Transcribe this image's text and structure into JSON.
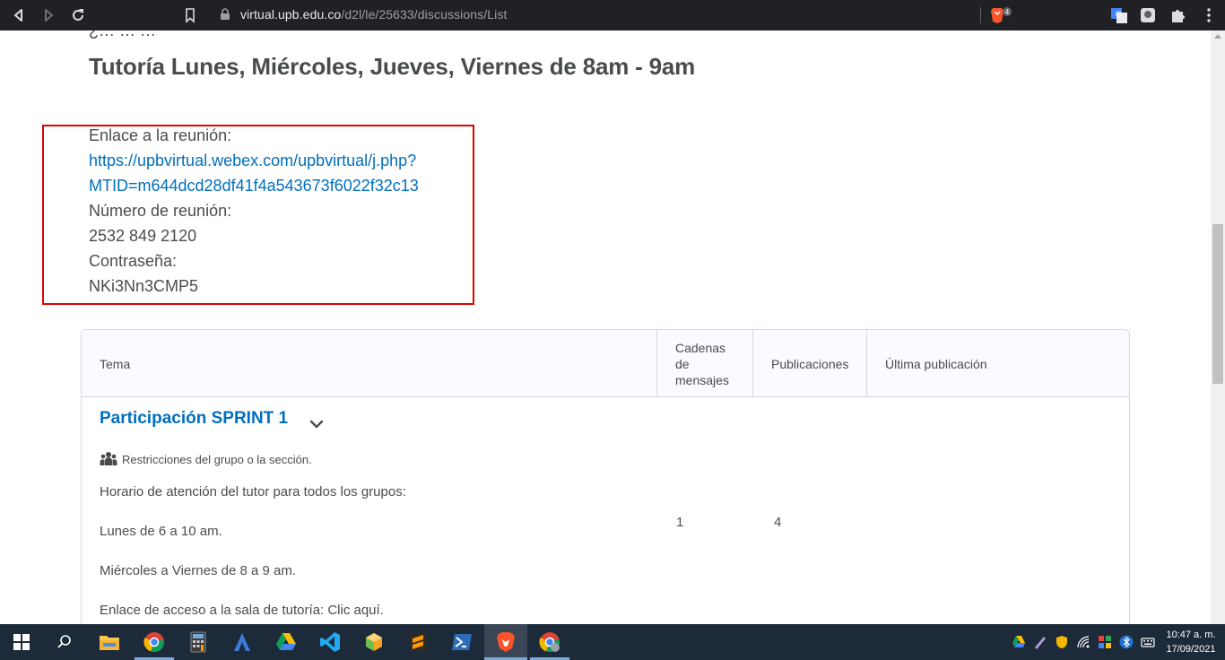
{
  "browser": {
    "url_host": "virtual.upb.edu.co",
    "url_path": "/d2l/le/25633/discussions/List",
    "shield_badge": "4"
  },
  "page": {
    "cut_text": "¿… … …",
    "heading": "Tutoría Lunes, Miércoles, Jueves, Viernes de 8am - 9am",
    "meeting": {
      "link_label": "Enlace a la reunión:",
      "link_line1": "https://upbvirtual.webex.com/upbvirtual/j.php?",
      "link_line2": "MTID=m644dcd28df41f4a543673f6022f32c13",
      "number_label": "Número de reunión:",
      "number_value": "2532 849 2120",
      "password_label": "Contraseña:",
      "password_value": "NKi3Nn3CMP5"
    },
    "table": {
      "headers": {
        "topic": "Tema",
        "threads_l1": "Cadenas",
        "threads_l2": "de",
        "threads_l3": "mensajes",
        "posts": "Publicaciones",
        "last_post": "Última publicación"
      },
      "row": {
        "title": "Participación SPRINT 1",
        "restriction": "Restricciones del grupo o la sección.",
        "desc1": "Horario de atención del tutor para todos los grupos:",
        "desc2": "Lunes de 6 a 10 am.",
        "desc3": "Miércoles a Viernes de 8 a 9 am.",
        "desc4": "Enlace de acceso a la sala de tutoría: Clic aquí.",
        "threads": "1",
        "posts": "4"
      }
    }
  },
  "taskbar": {
    "time": "10:47 a. m.",
    "date": "17/09/2021"
  },
  "colors": {
    "link": "#006fbf",
    "highlight_border": "#e00000",
    "taskbar": "#1c2a3a",
    "toolbar": "#202124"
  }
}
